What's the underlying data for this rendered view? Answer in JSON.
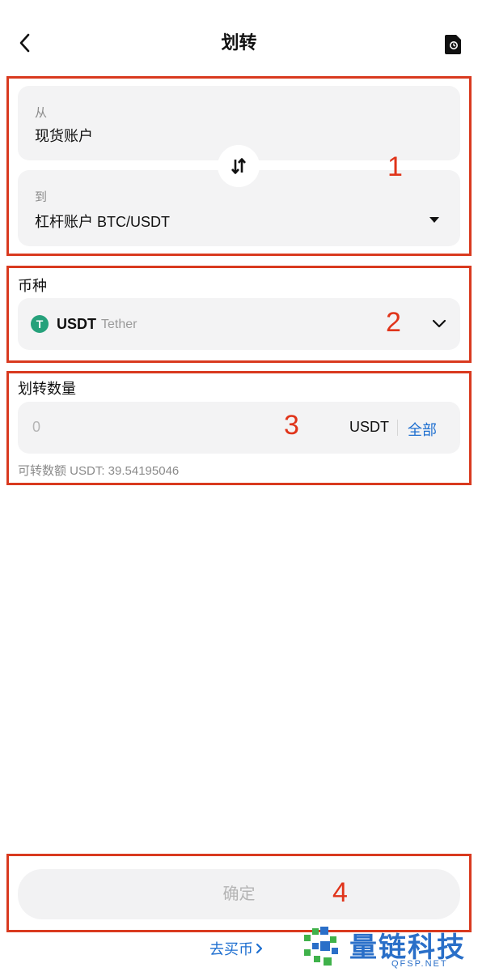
{
  "header": {
    "title": "划转"
  },
  "from_to": {
    "from_label": "从",
    "from_value": "现货账户",
    "to_label": "到",
    "to_value": "杠杆账户 BTC/USDT"
  },
  "coin": {
    "section_label": "币种",
    "symbol": "USDT",
    "name": "Tether",
    "icon_glyph": "T"
  },
  "amount": {
    "section_label": "划转数量",
    "placeholder": "0",
    "unit": "USDT",
    "all_label": "全部",
    "available_text": "可转数额 USDT: 39.54195046"
  },
  "footer": {
    "confirm_label": "确定",
    "buy_link": "去买币"
  },
  "annotations": {
    "n1": "1",
    "n2": "2",
    "n3": "3",
    "n4": "4"
  },
  "watermark": {
    "brand": "量链科技",
    "site": "QFSP.NET"
  },
  "colors": {
    "accent": "#1e6fd0",
    "annotation_red": "#d93a1f",
    "usdt_green": "#26a17b",
    "card_bg": "#f3f3f4"
  }
}
